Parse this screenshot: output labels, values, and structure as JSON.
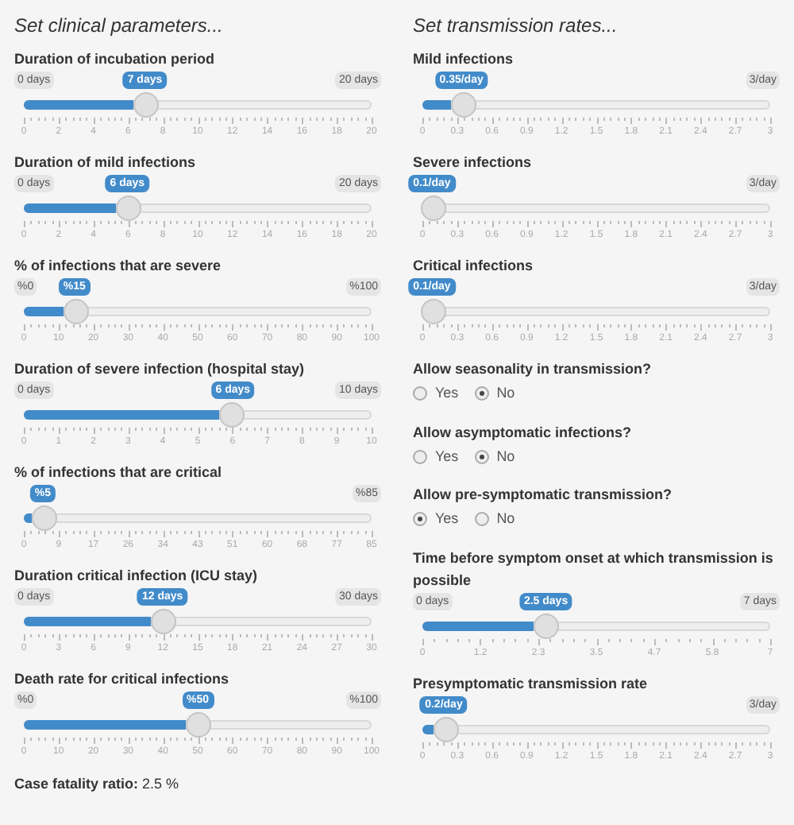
{
  "columns": [
    {
      "title": "Set clinical parameters...",
      "items": [
        {
          "kind": "slider",
          "label": "Duration of incubation period",
          "min": "0 days",
          "max": "20 days",
          "value": "7 days",
          "level": 0.35,
          "ticks": [
            "0",
            "2",
            "4",
            "6",
            "8",
            "10",
            "12",
            "14",
            "16",
            "18",
            "20"
          ]
        },
        {
          "kind": "slider",
          "label": "Duration of mild infections",
          "min": "0 days",
          "max": "20 days",
          "value": "6 days",
          "level": 0.3,
          "ticks": [
            "0",
            "2",
            "4",
            "6",
            "8",
            "10",
            "12",
            "14",
            "16",
            "18",
            "20"
          ]
        },
        {
          "kind": "slider",
          "label": "% of infections that are severe",
          "min": "%0",
          "max": "%100",
          "value": "%15",
          "level": 0.15,
          "ticks": [
            "0",
            "10",
            "20",
            "30",
            "40",
            "50",
            "60",
            "70",
            "80",
            "90",
            "100"
          ]
        },
        {
          "kind": "slider",
          "label": "Duration of severe infection (hospital stay)",
          "min": "0 days",
          "max": "10 days",
          "value": "6 days",
          "level": 0.6,
          "ticks": [
            "0",
            "1",
            "2",
            "3",
            "4",
            "5",
            "6",
            "7",
            "8",
            "9",
            "10"
          ]
        },
        {
          "kind": "slider",
          "label": "% of infections that are critical",
          "max": "%85",
          "value": "%5",
          "level": 0.06,
          "ticks": [
            "0",
            "9",
            "17",
            "26",
            "34",
            "43",
            "51",
            "60",
            "68",
            "77",
            "85"
          ]
        },
        {
          "kind": "slider",
          "label": "Duration critical infection (ICU stay)",
          "min": "0 days",
          "max": "30 days",
          "value": "12 days",
          "level": 0.4,
          "ticks": [
            "0",
            "3",
            "6",
            "9",
            "12",
            "15",
            "18",
            "21",
            "24",
            "27",
            "30"
          ]
        },
        {
          "kind": "slider",
          "label": "Death rate for critical infections",
          "min": "%0",
          "max": "%100",
          "value": "%50",
          "level": 0.5,
          "ticks": [
            "0",
            "10",
            "20",
            "30",
            "40",
            "50",
            "60",
            "70",
            "80",
            "90",
            "100"
          ]
        },
        {
          "kind": "result",
          "label": "Case fatality ratio:",
          "value": "2.5 %"
        }
      ]
    },
    {
      "title": "Set transmission rates...",
      "items": [
        {
          "kind": "slider",
          "label": "Mild infections",
          "max": "3/day",
          "value": "0.35/day",
          "level": 0.117,
          "ticks": [
            "0",
            "0.3",
            "0.6",
            "0.9",
            "1.2",
            "1.5",
            "1.8",
            "2.1",
            "2.4",
            "2.7",
            "3"
          ]
        },
        {
          "kind": "slider",
          "label": "Severe infections",
          "max": "3/day",
          "value": "0.1/day",
          "level": 0.033,
          "ticks": [
            "0",
            "0.3",
            "0.6",
            "0.9",
            "1.2",
            "1.5",
            "1.8",
            "2.1",
            "2.4",
            "2.7",
            "3"
          ]
        },
        {
          "kind": "slider",
          "label": "Critical infections",
          "max": "3/day",
          "value": "0.1/day",
          "level": 0.033,
          "ticks": [
            "0",
            "0.3",
            "0.6",
            "0.9",
            "1.2",
            "1.5",
            "1.8",
            "2.1",
            "2.4",
            "2.7",
            "3"
          ]
        },
        {
          "kind": "radio",
          "label": "Allow seasonality in transmission?",
          "options": [
            {
              "label": "Yes",
              "selected": false
            },
            {
              "label": "No",
              "selected": true
            }
          ]
        },
        {
          "kind": "radio",
          "label": "Allow asymptomatic infections?",
          "options": [
            {
              "label": "Yes",
              "selected": false
            },
            {
              "label": "No",
              "selected": true
            }
          ]
        },
        {
          "kind": "radio",
          "label": "Allow pre-symptomatic transmission?",
          "options": [
            {
              "label": "Yes",
              "selected": true
            },
            {
              "label": "No",
              "selected": false
            }
          ]
        },
        {
          "kind": "slider",
          "label": "Time before symptom onset at which transmission is possible",
          "min": "0 days",
          "max": "7 days",
          "value": "2.5 days",
          "level": 0.357,
          "ticks": [
            "0",
            "1.2",
            "2.3",
            "3.5",
            "4.7",
            "5.8",
            "7"
          ]
        },
        {
          "kind": "slider",
          "label": "Presymptomatic transmission rate",
          "max": "3/day",
          "value": "0.2/day",
          "level": 0.067,
          "ticks": [
            "0",
            "0.3",
            "0.6",
            "0.9",
            "1.2",
            "1.5",
            "1.8",
            "2.1",
            "2.4",
            "2.7",
            "3"
          ]
        }
      ]
    }
  ]
}
